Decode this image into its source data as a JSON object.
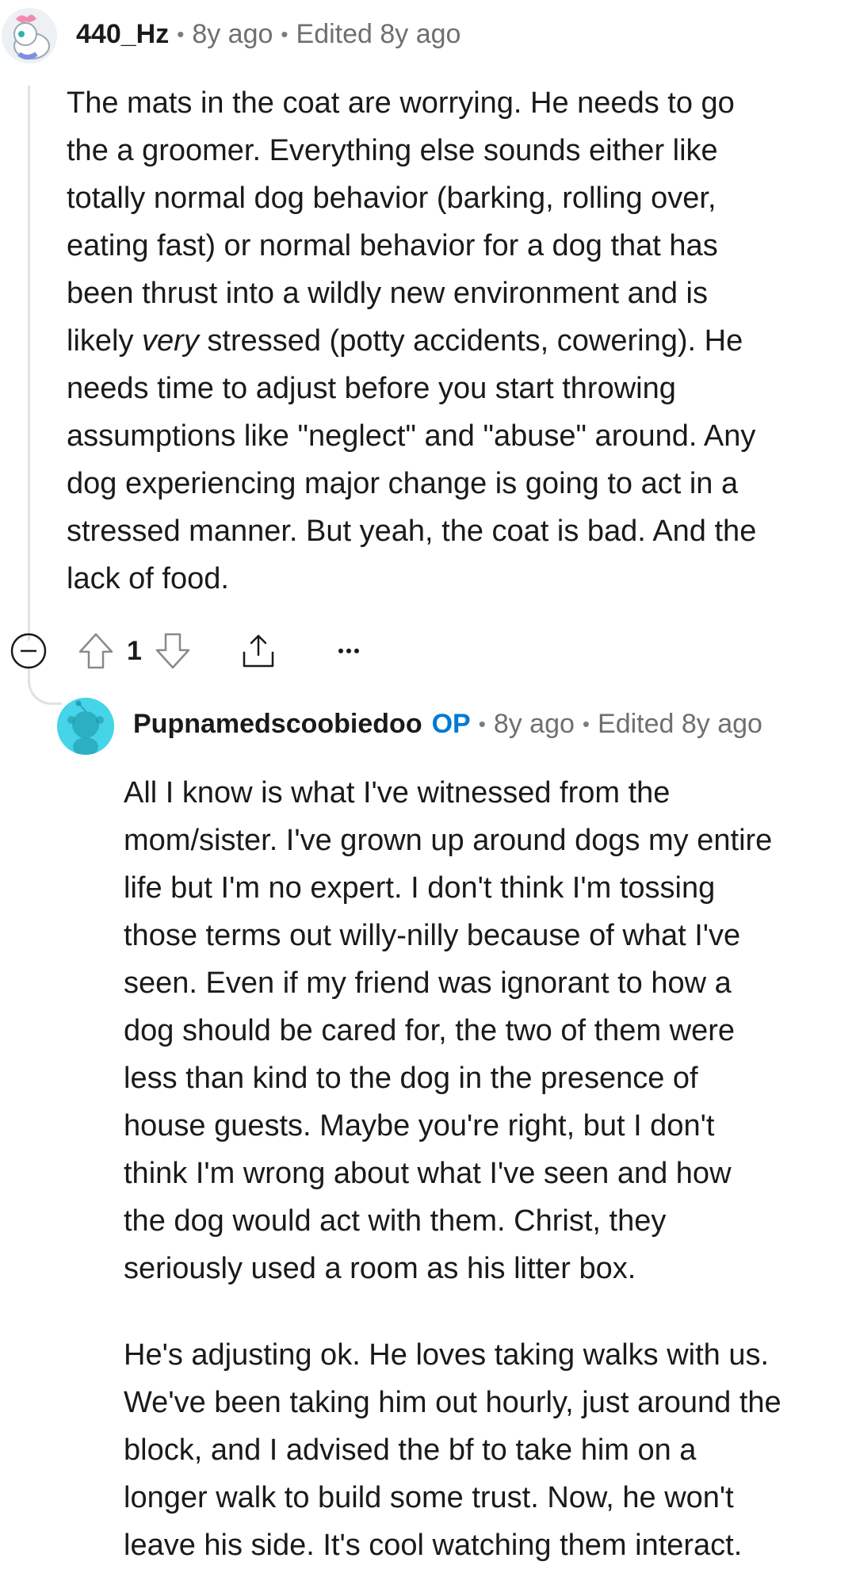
{
  "comment": {
    "username": "440_Hz",
    "time": "8y ago",
    "edited": "Edited 8y ago",
    "body_lines": [
      "The mats in the coat are worrying. He needs to go",
      "the a groomer. Everything else sounds either like",
      "totally normal dog behavior (barking, rolling over,",
      "eating fast) or normal behavior for a dog that has",
      "been thrust into a wildly new environment and is"
    ],
    "line6_before": "likely ",
    "line6_em": "very",
    "line6_after": " stressed (potty accidents, cowering). He",
    "body_lines_2": [
      "needs time to adjust before you start throwing",
      "assumptions like \"neglect\" and \"abuse\" around. Any",
      "dog experiencing major change is going to act in a",
      "stressed manner. But yeah, the coat is bad. And the",
      "lack of food."
    ],
    "votes": "1",
    "icons": {
      "collapse": "collapse-minus-icon",
      "upvote": "upvote-arrow-icon",
      "downvote": "downvote-arrow-icon",
      "share": "share-icon",
      "more": "more-options-icon"
    }
  },
  "reply": {
    "username": "Pupnamedscoobiedoo",
    "op_badge": "OP",
    "time": "8y ago",
    "edited": "Edited 8y ago",
    "paragraph1_lines": [
      "All I know is what I've witnessed from the",
      "mom/sister. I've grown up around dogs my entire",
      "life but I'm no expert. I don't think I'm tossing",
      "those terms out willy-nilly because of what I've",
      "seen. Even if my friend was ignorant to how a",
      "dog should be cared for, the two of them were",
      "less than kind to the dog in the presence of",
      "house guests. Maybe you're right, but I don't",
      "think I'm wrong about what I've seen and how",
      "the dog would act with them. Christ, they",
      "seriously used a room as his litter box."
    ],
    "paragraph2_lines": [
      "He's adjusting ok. He loves taking walks with us.",
      "We've been taking him out hourly, just around the",
      "block, and I advised the bf to take him on a",
      "longer walk to build some trust. Now, he won't",
      "leave his side. It's cool watching them interact."
    ]
  },
  "colors": {
    "op_badge": "#0079d3",
    "reply_avatar_bg": "#45d4e8",
    "thread_line": "#dfe1e3"
  }
}
